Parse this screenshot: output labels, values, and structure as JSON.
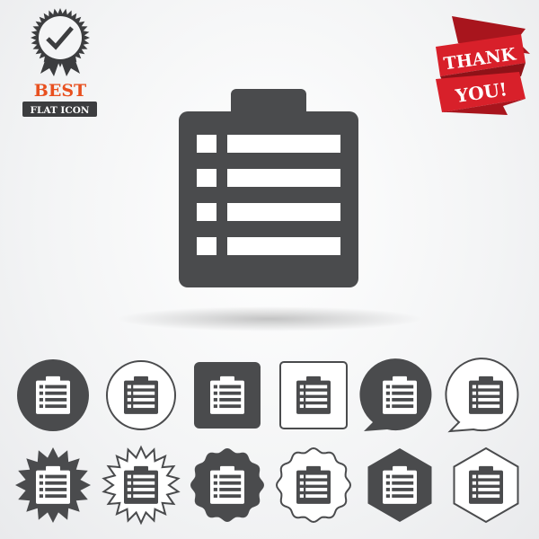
{
  "badge": {
    "title": "BEST",
    "subtitle": "FLAT ICON",
    "icon": "check-award-icon",
    "title_color": "#e8501f"
  },
  "ribbon": {
    "line1": "THANK",
    "line2": "YOU!",
    "color": "#d8202a"
  },
  "main_icon": {
    "icon": "clipboard-list-icon",
    "color": "#4a4b4d",
    "rows": 4
  },
  "variants": [
    {
      "shape": "circle",
      "style": "filled"
    },
    {
      "shape": "circle",
      "style": "outline"
    },
    {
      "shape": "square",
      "style": "filled"
    },
    {
      "shape": "square",
      "style": "outline"
    },
    {
      "shape": "speech-bubble",
      "style": "filled"
    },
    {
      "shape": "speech-bubble",
      "style": "outline"
    },
    {
      "shape": "starburst",
      "style": "filled"
    },
    {
      "shape": "starburst",
      "style": "outline"
    },
    {
      "shape": "wavy-circle",
      "style": "filled"
    },
    {
      "shape": "wavy-circle",
      "style": "outline"
    },
    {
      "shape": "hexagon",
      "style": "filled"
    },
    {
      "shape": "hexagon",
      "style": "outline"
    }
  ]
}
